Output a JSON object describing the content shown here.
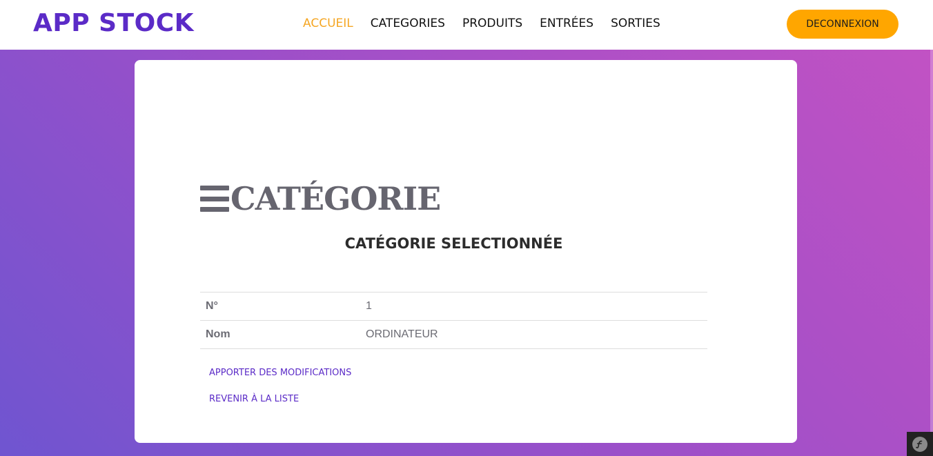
{
  "navbar": {
    "brand": "APP STOCK",
    "links": [
      {
        "label": "ACCUEIL",
        "active": true
      },
      {
        "label": "CATEGORIES",
        "active": false
      },
      {
        "label": "PRODUITS",
        "active": false
      },
      {
        "label": "ENTRÉES",
        "active": false
      },
      {
        "label": "SORTIES",
        "active": false
      }
    ],
    "logout_label": "DECONNEXION"
  },
  "page": {
    "heading_icon": "bars-icon",
    "heading": "CATÉGORIE",
    "subtitle": "CATÉGORIE SELECTIONNÉE"
  },
  "details": {
    "rows": [
      {
        "label": "N°",
        "value": "1"
      },
      {
        "label": "Nom",
        "value": "ORDINATEUR"
      }
    ]
  },
  "actions": {
    "edit_label": "APPORTER DES MODIFICATIONS",
    "back_label": "REVENIR À LA LISTE"
  },
  "toolbar": {
    "icon": "symfony-icon"
  },
  "colors": {
    "brand": "#5b2bc7",
    "accent": "#ffa600",
    "active_link": "#f5a623",
    "heading": "#66656f",
    "gradient_start": "#6f55d0",
    "gradient_end": "#c452c3"
  }
}
